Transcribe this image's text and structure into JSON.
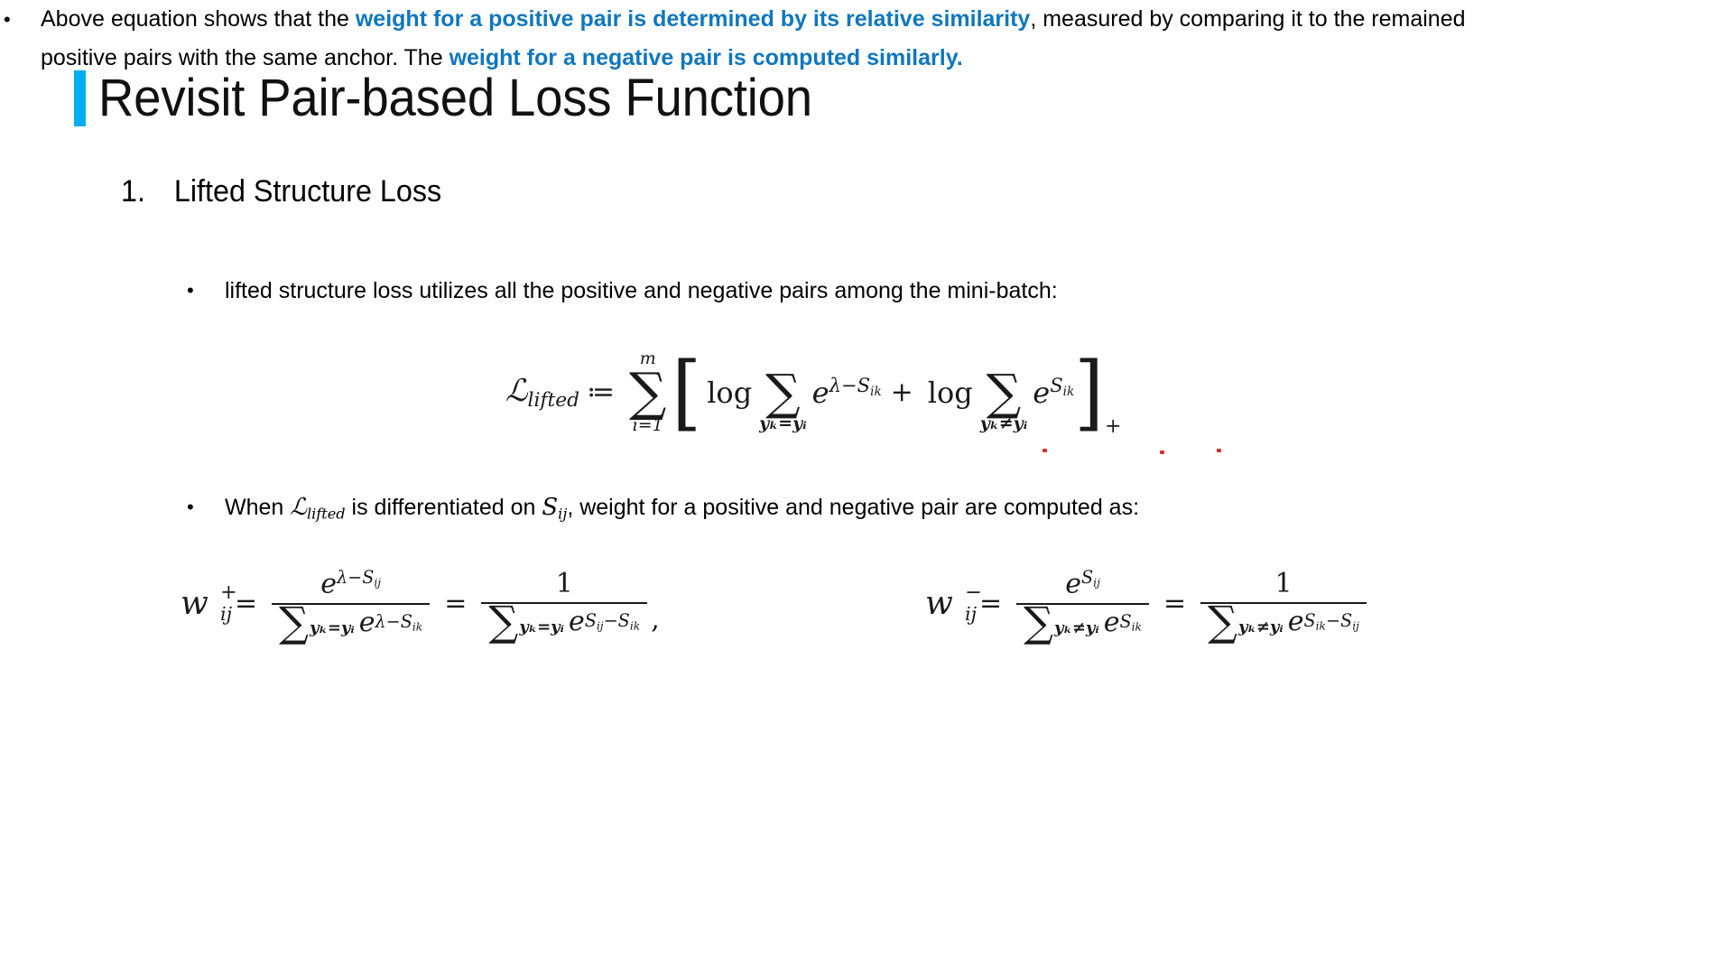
{
  "slide": {
    "title": "Revisit Pair-based Loss Function",
    "accent_color": "#00AEEF",
    "highlight_color": "#0F77BF",
    "background_color": "#FFFFFF"
  },
  "heading": {
    "number": "1.",
    "text": "Lifted Structure Loss"
  },
  "bullets": {
    "marker": "•",
    "one": {
      "text": "lifted structure loss utilizes all the positive and negative pairs among the mini-batch:"
    },
    "two": {
      "part1": "When",
      "math_loss": "ℒ",
      "math_loss_sub": "lifted",
      "part2": "is differentiated on",
      "math_s": "S",
      "math_s_sub": "ij",
      "part3": ", weight for a positive and negative pair are computed as:"
    },
    "three": {
      "seg1": "Above equation shows that the ",
      "hl1": "weight for a positive pair is determined by its relative similarity",
      "seg2": ", measured by comparing it to the remained positive pairs with the same anchor. The ",
      "hl2": "weight for a negative pair is computed similarly."
    }
  },
  "equations": {
    "main": {
      "latex": "\\mathcal{L}_{lifted} := \\sum_{i=1}^{m}\\left[\\log\\sum_{\\boldsymbol{y}_k=\\boldsymbol{y}_i} e^{\\lambda - S_{ik}} + \\log\\sum_{\\boldsymbol{y}_k \\neq \\boldsymbol{y}_i} e^{S_{ik}}\\right]_{+}",
      "lhs_symbol": "ℒ",
      "lhs_sub": "lifted",
      "assign": "≔",
      "sum_glyph": "∑",
      "sum_upper": "m",
      "sum_lower": "i=1",
      "bracket_open": "[",
      "bracket_close": "]",
      "log": "log",
      "inner_sum1_lower": "𝒚ₖ=𝒚ᵢ",
      "exp1_base": "e",
      "exp1_power": "λ−S",
      "exp1_power_sub": "ik",
      "plus": "+",
      "inner_sum2_lower": "𝒚ₖ≠𝒚ᵢ",
      "exp2_base": "e",
      "exp2_power": "S",
      "exp2_power_sub": "ik",
      "bracket_subscript": "+"
    },
    "weight_positive": {
      "latex": "w^{+}_{ij} = \\frac{e^{\\lambda - S_{ij}}}{\\sum_{\\boldsymbol{y}_k=\\boldsymbol{y}_i} e^{\\lambda - S_{ik}}} = \\frac{1}{\\sum_{\\boldsymbol{y}_k=\\boldsymbol{y}_i} e^{S_{ij}-S_{ik}}},",
      "w": "w",
      "w_sup": "+",
      "w_sub": "ij",
      "eq": "=",
      "frac1_num_base": "e",
      "frac1_num_pow": "λ−S",
      "frac1_num_pow_sub": "ij",
      "frac1_den_sum": "∑",
      "frac1_den_lim": "𝒚ₖ=𝒚ᵢ",
      "frac1_den_base": "e",
      "frac1_den_pow": "λ−S",
      "frac1_den_pow_sub": "ik",
      "frac2_num": "1",
      "frac2_den_sum": "∑",
      "frac2_den_lim": "𝒚ₖ=𝒚ᵢ",
      "frac2_den_base": "e",
      "frac2_den_pow": "S",
      "frac2_den_pow_sub1": "ij",
      "frac2_den_pow_minus": "−S",
      "frac2_den_pow_sub2": "ik",
      "trailing": ","
    },
    "weight_negative": {
      "latex": "w^{-}_{ij} = \\frac{e^{S_{ij}}}{\\sum_{\\boldsymbol{y}_k \\neq \\boldsymbol{y}_i} e^{S_{ik}}} = \\frac{1}{\\sum_{\\boldsymbol{y}_k \\neq \\boldsymbol{y}_i} e^{S_{ik}-S_{ij}}}",
      "w": "w",
      "w_sup": "−",
      "w_sub": "ij",
      "eq": "=",
      "frac1_num_base": "e",
      "frac1_num_pow": "S",
      "frac1_num_pow_sub": "ij",
      "frac1_den_sum": "∑",
      "frac1_den_lim": "𝒚ₖ≠𝒚ᵢ",
      "frac1_den_base": "e",
      "frac1_den_pow": "S",
      "frac1_den_pow_sub": "ik",
      "frac2_num": "1",
      "frac2_den_sum": "∑",
      "frac2_den_lim": "𝒚ₖ≠𝒚ᵢ",
      "frac2_den_base": "e",
      "frac2_den_pow": "S",
      "frac2_den_pow_sub1": "ik",
      "frac2_den_pow_minus": "−S",
      "frac2_den_pow_sub2": "ij"
    }
  }
}
